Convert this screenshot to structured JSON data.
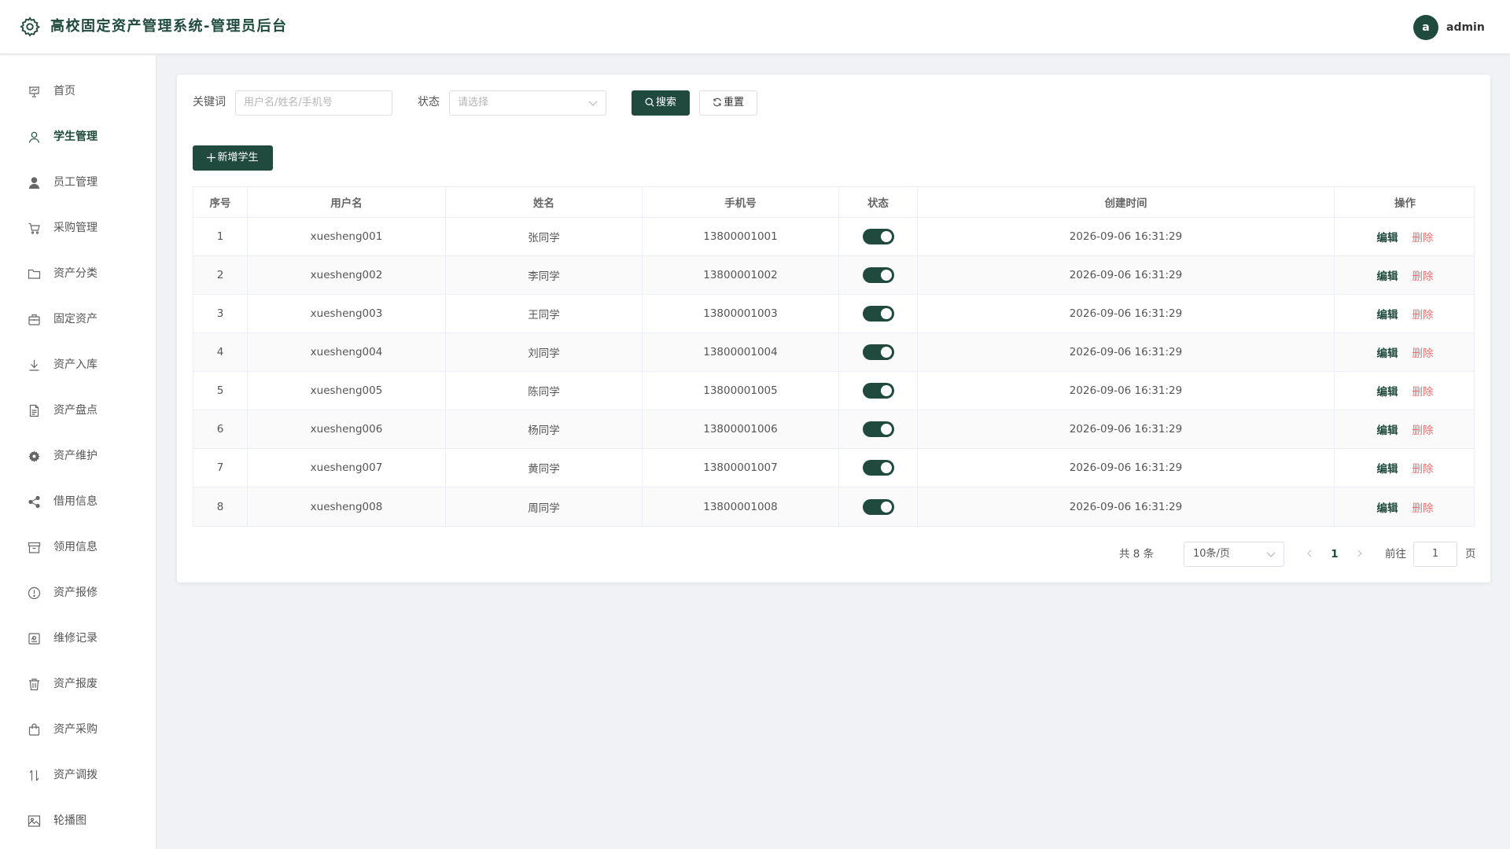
{
  "header": {
    "title": "高校固定资产管理系统-管理员后台",
    "avatar_letter": "a",
    "username": "admin"
  },
  "sidebar": {
    "items": [
      {
        "label": "首页",
        "icon": "presentation-chart-icon",
        "active": false
      },
      {
        "label": "学生管理",
        "icon": "user-outline-icon",
        "active": true
      },
      {
        "label": "员工管理",
        "icon": "user-filled-icon",
        "active": false
      },
      {
        "label": "采购管理",
        "icon": "shopping-cart-icon",
        "active": false
      },
      {
        "label": "资产分类",
        "icon": "folder-icon",
        "active": false
      },
      {
        "label": "固定资产",
        "icon": "briefcase-icon",
        "active": false
      },
      {
        "label": "资产入库",
        "icon": "download-icon",
        "active": false
      },
      {
        "label": "资产盘点",
        "icon": "document-icon",
        "active": false
      },
      {
        "label": "资产维护",
        "icon": "gear-icon",
        "active": false
      },
      {
        "label": "借用信息",
        "icon": "share-icon",
        "active": false
      },
      {
        "label": "领用信息",
        "icon": "box-icon",
        "active": false
      },
      {
        "label": "资产报修",
        "icon": "warning-circle-icon",
        "active": false
      },
      {
        "label": "维修记录",
        "icon": "record-icon",
        "active": false
      },
      {
        "label": "资产报废",
        "icon": "trash-icon",
        "active": false
      },
      {
        "label": "资产采购",
        "icon": "shopping-bag-icon",
        "active": false
      },
      {
        "label": "资产调拨",
        "icon": "transfer-icon",
        "active": false
      },
      {
        "label": "轮播图",
        "icon": "picture-icon",
        "active": false
      }
    ]
  },
  "filter": {
    "keyword_label": "关键词",
    "keyword_value": "",
    "keyword_placeholder": "用户名/姓名/手机号",
    "status_label": "状态",
    "status_placeholder": "请选择",
    "search_label": "搜索",
    "reset_label": "重置"
  },
  "add_button_label": "新增学生",
  "table": {
    "headers": [
      "序号",
      "用户名",
      "姓名",
      "手机号",
      "状态",
      "创建时间",
      "操作"
    ],
    "rows": [
      {
        "index": "1",
        "username": "xuesheng001",
        "name": "张同学",
        "phone": "13800001001",
        "status_on": true,
        "created": "2026-09-06 16:31:29"
      },
      {
        "index": "2",
        "username": "xuesheng002",
        "name": "李同学",
        "phone": "13800001002",
        "status_on": true,
        "created": "2026-09-06 16:31:29"
      },
      {
        "index": "3",
        "username": "xuesheng003",
        "name": "王同学",
        "phone": "13800001003",
        "status_on": true,
        "created": "2026-09-06 16:31:29"
      },
      {
        "index": "4",
        "username": "xuesheng004",
        "name": "刘同学",
        "phone": "13800001004",
        "status_on": true,
        "created": "2026-09-06 16:31:29"
      },
      {
        "index": "5",
        "username": "xuesheng005",
        "name": "陈同学",
        "phone": "13800001005",
        "status_on": true,
        "created": "2026-09-06 16:31:29"
      },
      {
        "index": "6",
        "username": "xuesheng006",
        "name": "杨同学",
        "phone": "13800001006",
        "status_on": true,
        "created": "2026-09-06 16:31:29"
      },
      {
        "index": "7",
        "username": "xuesheng007",
        "name": "黄同学",
        "phone": "13800001007",
        "status_on": true,
        "created": "2026-09-06 16:31:29"
      },
      {
        "index": "8",
        "username": "xuesheng008",
        "name": "周同学",
        "phone": "13800001008",
        "status_on": true,
        "created": "2026-09-06 16:31:29"
      }
    ],
    "edit_label": "编辑",
    "delete_label": "删除"
  },
  "pagination": {
    "total_text": "共 8 条",
    "page_size": "10条/页",
    "current_page": "1",
    "goto_label": "前往",
    "goto_value": "1",
    "page_suffix": "页"
  },
  "colors": {
    "brand": "#1f4a3d",
    "danger": "#f56c6c",
    "background": "#f0f2f5"
  }
}
